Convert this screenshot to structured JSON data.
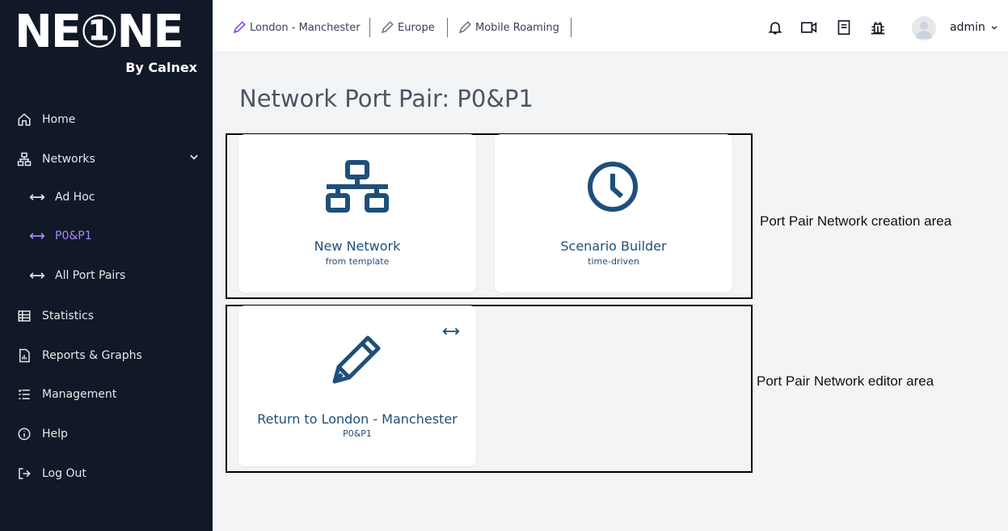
{
  "brand": {
    "logo_text": "NE①NE",
    "by_text": "By Calnex"
  },
  "sidebar": {
    "items": [
      {
        "label": "Home",
        "icon": "home-icon"
      },
      {
        "label": "Networks",
        "icon": "network-icon"
      },
      {
        "label": "Ad Hoc",
        "icon": "bidirectional-arrow-icon"
      },
      {
        "label": "P0&P1",
        "icon": "bidirectional-arrow-icon"
      },
      {
        "label": "All Port Pairs",
        "icon": "bidirectional-arrow-icon"
      },
      {
        "label": "Statistics",
        "icon": "table-icon"
      },
      {
        "label": "Reports & Graphs",
        "icon": "report-icon"
      },
      {
        "label": "Management",
        "icon": "list-icon"
      },
      {
        "label": "Help",
        "icon": "info-icon"
      },
      {
        "label": "Log Out",
        "icon": "logout-icon"
      }
    ]
  },
  "topbar": {
    "breadcrumbs": [
      "London - Manchester",
      "Europe",
      "Mobile Roaming"
    ],
    "user": "admin"
  },
  "main": {
    "title": "Network Port Pair: P0&P1",
    "cards": [
      {
        "title": "New Network",
        "subtitle": "from template"
      },
      {
        "title": "Scenario Builder",
        "subtitle": "time-driven"
      },
      {
        "title": "Return to London - Manchester",
        "subtitle": "P0&P1"
      }
    ],
    "annotations": {
      "creation_area": "Port Pair Network creation area",
      "editor_area": "Port Pair Network editor area"
    }
  },
  "colors": {
    "sidebar_bg": "#111827",
    "accent": "#a78bfa",
    "card_text": "#1e4f7a"
  }
}
